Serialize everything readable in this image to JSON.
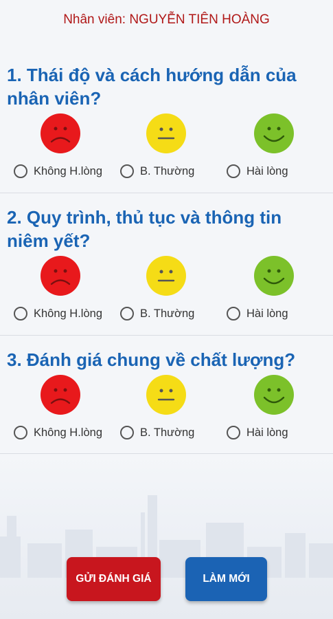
{
  "header": {
    "employee_label": "Nhân viên:",
    "employee_name": "NGUYỄN TIÊN HOÀNG"
  },
  "questions": [
    {
      "title": "1. Thái độ và cách hướng dẫn của nhân viên?"
    },
    {
      "title": "2. Quy trình, thủ tục và thông tin niêm yết?"
    },
    {
      "title": "3. Đánh giá chung về chất lượng?"
    }
  ],
  "options": {
    "bad": "Không H.lòng",
    "normal": "B. Thường",
    "good": "Hài lòng"
  },
  "faces": {
    "bad_icon": "sad-face-icon",
    "normal_icon": "neutral-face-icon",
    "good_icon": "happy-face-icon"
  },
  "colors": {
    "bad": "#e8191c",
    "normal": "#f5dc16",
    "good": "#7cc12a",
    "title": "#1a64b4",
    "header": "#b01818",
    "send_button": "#c8161e",
    "reset_button": "#1b63b4"
  },
  "buttons": {
    "send": "GỬI ĐÁNH GIÁ",
    "reset": "LÀM MỚI"
  }
}
